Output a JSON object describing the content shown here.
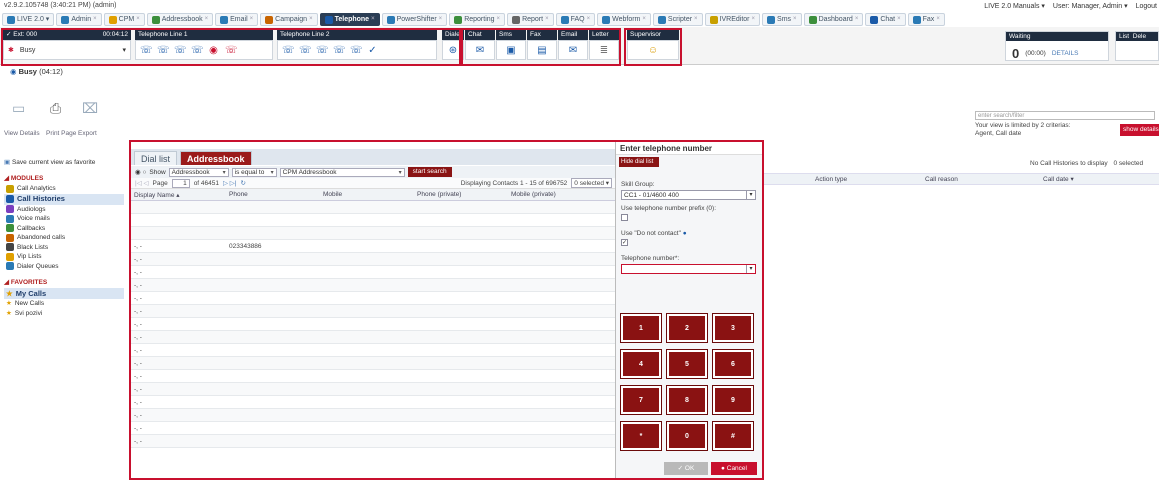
{
  "version": "v2.9.2.105748 (3:40:21 PM) (admin)",
  "topright": {
    "manuals": "LIVE 2.0 Manuals ▾",
    "user": "User: Manager, Admin ▾",
    "logout": "Logout"
  },
  "tabs": [
    "LIVE 2.0 ▾",
    "Admin",
    "CPM",
    "Addressbook",
    "Email",
    "Campaign",
    "Telephone",
    "PowerShifter",
    "Reporting",
    "Report",
    "FAQ",
    "Webform",
    "Scripter",
    "IVREditor",
    "Sms",
    "Dashboard",
    "Chat",
    "Fax"
  ],
  "active_tab": "Telephone",
  "toolbar": {
    "ext_label": "✓ Ext: 000",
    "ext_time": "00:04:12",
    "status_value": "Busy",
    "line1": "Telephone Line 1",
    "line2": "Telephone Line 2",
    "dialer": "Dialer",
    "chat": "Chat",
    "sms": "Sms",
    "fax": "Fax",
    "email": "Email",
    "letter": "Letter",
    "supervisor": "Supervisor"
  },
  "waiting": {
    "title": "Waiting",
    "count": "0",
    "time": "(00:00)",
    "details": "DETAILS"
  },
  "list_label": "List",
  "dele_label": "Dele",
  "status_row": {
    "state": "Busy",
    "time": "(04:12)"
  },
  "actions": [
    "View Details",
    "Print Page",
    "Export"
  ],
  "save_favorite": "Save current view as favorite",
  "modules_title": "MODULES",
  "modules": [
    "Call Analytics",
    "Call Histories",
    "Audiologs",
    "Voice mails",
    "Callbacks",
    "Abandoned calls",
    "Black Lists",
    "Vip Lists",
    "Dialer Queues"
  ],
  "favorites_title": "FAVORITES",
  "favorites": [
    "My Calls",
    "New Calls",
    "Svi pozivi"
  ],
  "filter": {
    "placeholder": "enter search/filter",
    "note": "Your view is limited by 2 criterias: Agent, Call date",
    "show_details": "show details"
  },
  "history": {
    "no_hist": "No Call Histories to display",
    "selected": "0 selected",
    "columns": [
      "Action type",
      "Call reason",
      "Call date ▾"
    ]
  },
  "dial": {
    "tabs": [
      "Dial list",
      "Addressbook"
    ],
    "show": "Show",
    "source": "Addressbook",
    "operator": "is equal to",
    "target": "CPM Addressbook",
    "start": "start search",
    "page_label": "Page",
    "page_value": "1",
    "page_of": "of 46451",
    "displaying": "Displaying Contacts 1 - 15 of 696752",
    "selected": "0 selected ▾",
    "columns": [
      "Display Name ▴",
      "Phone",
      "Mobile",
      "Phone (private)",
      "Mobile (private)"
    ],
    "rows": [
      {
        "name": "",
        "phone": ""
      },
      {
        "name": "",
        "phone": ""
      },
      {
        "name": "",
        "phone": ""
      },
      {
        "name": "-, -",
        "phone": "023343886"
      },
      {
        "name": "-, -",
        "phone": ""
      },
      {
        "name": "-, -",
        "phone": ""
      },
      {
        "name": "-, -",
        "phone": ""
      },
      {
        "name": "-, -",
        "phone": ""
      },
      {
        "name": "-, -",
        "phone": ""
      },
      {
        "name": "-, -",
        "phone": ""
      },
      {
        "name": "-, -",
        "phone": ""
      },
      {
        "name": "-, -",
        "phone": ""
      },
      {
        "name": "-, -",
        "phone": ""
      },
      {
        "name": "-, -",
        "phone": ""
      },
      {
        "name": "-, -",
        "phone": ""
      },
      {
        "name": "-, -",
        "phone": ""
      },
      {
        "name": "-, -",
        "phone": ""
      },
      {
        "name": "-, -",
        "phone": ""
      },
      {
        "name": "-, -",
        "phone": ""
      }
    ]
  },
  "enter_phone": {
    "title": "Enter telephone number",
    "hide": "Hide dial list",
    "skill_label": "Skill Group:",
    "skill_value": "CC1 - 01/4600 400",
    "prefix_label": "Use telephone number prefix (0):",
    "dnc_label": "Use \"Do not contact\"",
    "dnc_checked": "✓",
    "phone_label": "Telephone number*:",
    "phone_value": "",
    "keys": [
      "1",
      "2",
      "3",
      "4",
      "5",
      "6",
      "7",
      "8",
      "9",
      "*",
      "0",
      "#"
    ],
    "ok": "OK",
    "cancel": "Cancel"
  }
}
